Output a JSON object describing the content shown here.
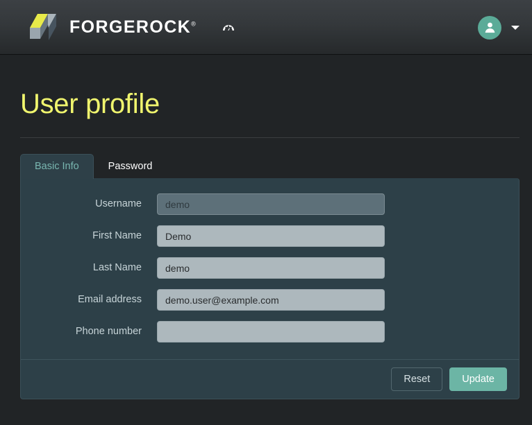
{
  "header": {
    "brand_name": "FORGEROCK",
    "brand_tm": "®",
    "logo_icon": "forgerock-cube-logo",
    "nav_icon": "dashboard-speedometer-icon",
    "avatar_icon": "user-avatar-icon",
    "caret_icon": "chevron-down-icon",
    "colors": {
      "avatar_bg": "#5bab98",
      "logo_yellow": "#e8ea4a",
      "logo_gray": "#9aa5ad",
      "logo_dark": "#4a5b68"
    }
  },
  "page": {
    "title": "User profile",
    "title_color": "#f0f56e"
  },
  "tabs": [
    {
      "label": "Basic Info",
      "active": true
    },
    {
      "label": "Password",
      "active": false
    }
  ],
  "form": {
    "fields": [
      {
        "label": "Username",
        "value": "demo",
        "placeholder": "",
        "disabled": true,
        "name": "username-input"
      },
      {
        "label": "First Name",
        "value": "Demo",
        "placeholder": "",
        "disabled": false,
        "name": "first-name-input"
      },
      {
        "label": "Last Name",
        "value": "demo",
        "placeholder": "",
        "disabled": false,
        "name": "last-name-input"
      },
      {
        "label": "Email address",
        "value": "demo.user@example.com",
        "placeholder": "",
        "disabled": false,
        "name": "email-address-input"
      },
      {
        "label": "Phone number",
        "value": "",
        "placeholder": "",
        "disabled": false,
        "name": "phone-number-input"
      }
    ]
  },
  "footer": {
    "reset_label": "Reset",
    "update_label": "Update",
    "update_color": "#6cb5a5"
  }
}
